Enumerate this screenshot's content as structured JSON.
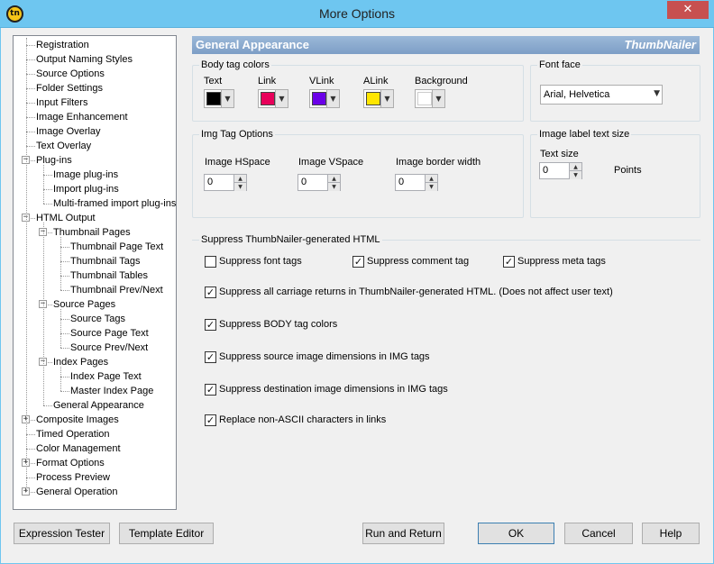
{
  "window": {
    "title": "More Options",
    "app_icon": "tn",
    "close": "✕"
  },
  "tree": [
    {
      "label": "Registration",
      "level": 0,
      "expander": ""
    },
    {
      "label": "Output Naming Styles",
      "level": 0,
      "expander": ""
    },
    {
      "label": "Source Options",
      "level": 0,
      "expander": ""
    },
    {
      "label": "Folder Settings",
      "level": 0,
      "expander": ""
    },
    {
      "label": "Input Filters",
      "level": 0,
      "expander": ""
    },
    {
      "label": "Image Enhancement",
      "level": 0,
      "expander": ""
    },
    {
      "label": "Image Overlay",
      "level": 0,
      "expander": ""
    },
    {
      "label": "Text Overlay",
      "level": 0,
      "expander": ""
    },
    {
      "label": "Plug-ins",
      "level": 0,
      "expander": "−"
    },
    {
      "label": "Image plug-ins",
      "level": 1,
      "expander": ""
    },
    {
      "label": "Import plug-ins",
      "level": 1,
      "expander": ""
    },
    {
      "label": "Multi-framed import plug-ins",
      "level": 1,
      "expander": ""
    },
    {
      "label": "HTML Output",
      "level": 0,
      "expander": "−"
    },
    {
      "label": "Thumbnail Pages",
      "level": 1,
      "expander": "−"
    },
    {
      "label": "Thumbnail Page Text",
      "level": 2,
      "expander": ""
    },
    {
      "label": "Thumbnail Tags",
      "level": 2,
      "expander": ""
    },
    {
      "label": "Thumbnail Tables",
      "level": 2,
      "expander": ""
    },
    {
      "label": "Thumbnail Prev/Next",
      "level": 2,
      "expander": ""
    },
    {
      "label": "Source Pages",
      "level": 1,
      "expander": "−"
    },
    {
      "label": "Source Tags",
      "level": 2,
      "expander": ""
    },
    {
      "label": "Source Page Text",
      "level": 2,
      "expander": ""
    },
    {
      "label": "Source Prev/Next",
      "level": 2,
      "expander": ""
    },
    {
      "label": "Index Pages",
      "level": 1,
      "expander": "−"
    },
    {
      "label": "Index Page Text",
      "level": 2,
      "expander": ""
    },
    {
      "label": "Master Index Page",
      "level": 2,
      "expander": ""
    },
    {
      "label": "General Appearance",
      "level": 1,
      "expander": ""
    },
    {
      "label": "Composite Images",
      "level": 0,
      "expander": "+"
    },
    {
      "label": "Timed Operation",
      "level": 0,
      "expander": ""
    },
    {
      "label": "Color Management",
      "level": 0,
      "expander": ""
    },
    {
      "label": "Format Options",
      "level": 0,
      "expander": "+"
    },
    {
      "label": "Process Preview",
      "level": 0,
      "expander": ""
    },
    {
      "label": "General Operation",
      "level": 0,
      "expander": "+"
    }
  ],
  "header": {
    "title": "General Appearance",
    "brand": "ThumbNailer"
  },
  "body_colors": {
    "title": "Body tag colors",
    "items": [
      {
        "label": "Text",
        "color": "#000000"
      },
      {
        "label": "Link",
        "color": "#e8005a"
      },
      {
        "label": "VLink",
        "color": "#6b00e8"
      },
      {
        "label": "ALink",
        "color": "#ffe600"
      },
      {
        "label": "Background",
        "color": "#ffffff"
      }
    ]
  },
  "font_face": {
    "title": "Font face",
    "value": "Arial, Helvetica"
  },
  "img_tag": {
    "title": "Img Tag Options",
    "hspace": {
      "label": "Image HSpace",
      "value": "0"
    },
    "vspace": {
      "label": "Image VSpace",
      "value": "0"
    },
    "border": {
      "label": "Image border width",
      "value": "0"
    }
  },
  "label_text": {
    "title": "Image label text size",
    "field_label": "Text size",
    "value": "0",
    "unit": "Points"
  },
  "suppress": {
    "title": "Suppress ThumbNailer-generated HTML",
    "font_tags": {
      "label": "Suppress font tags",
      "checked": false
    },
    "comment_tag": {
      "label": "Suppress comment tag",
      "checked": true
    },
    "meta_tags": {
      "label": "Suppress meta tags",
      "checked": true
    },
    "carriage": {
      "label": "Suppress all carriage returns in ThumbNailer-generated HTML. (Does not affect user text)",
      "checked": true
    },
    "body_colors": {
      "label": "Suppress BODY tag colors",
      "checked": true
    },
    "src_dims": {
      "label": "Suppress source image dimensions in IMG tags",
      "checked": true
    },
    "dst_dims": {
      "label": "Suppress destination image dimensions in IMG tags",
      "checked": true
    },
    "nonascii": {
      "label": "Replace non-ASCII characters in links",
      "checked": true
    }
  },
  "buttons": {
    "expression": "Expression Tester",
    "template": "Template Editor",
    "run": "Run and Return",
    "ok": "OK",
    "cancel": "Cancel",
    "help": "Help"
  }
}
